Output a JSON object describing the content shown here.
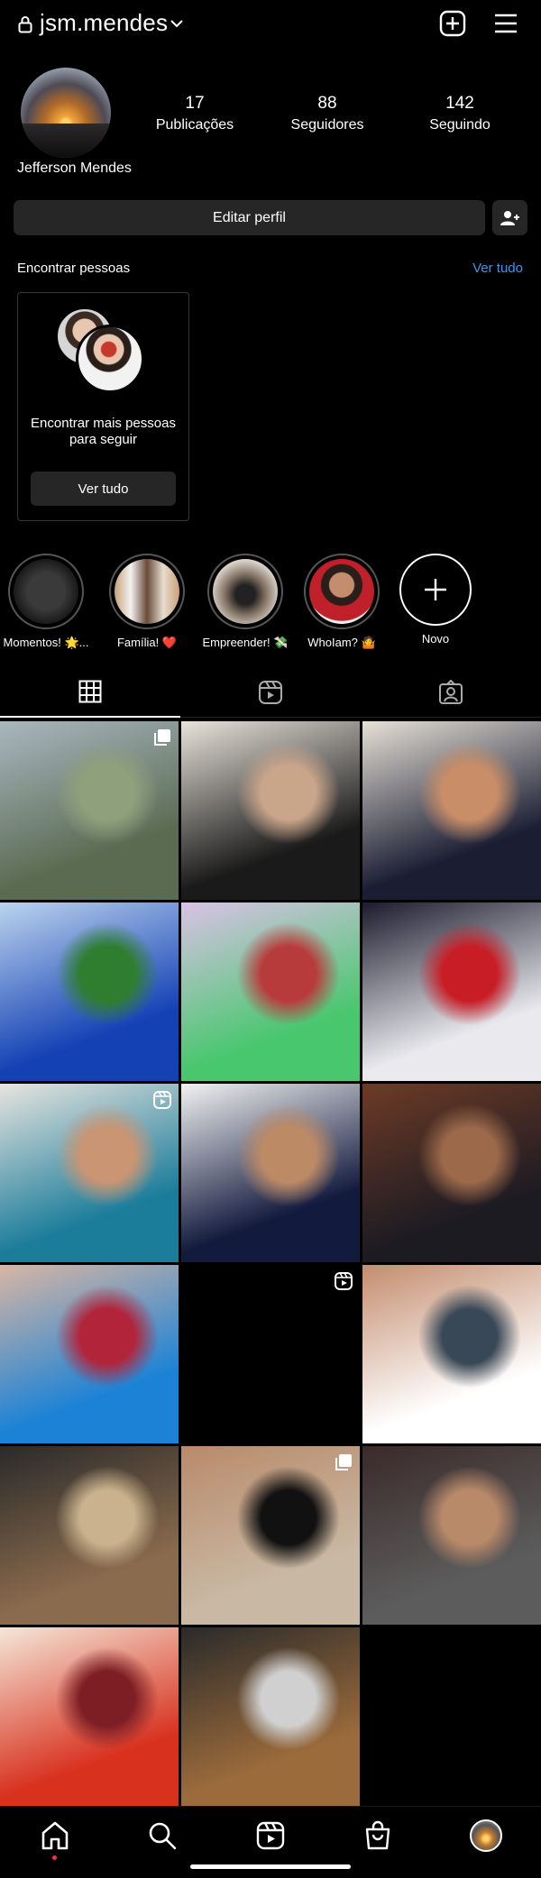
{
  "header": {
    "username": "jsm.mendes",
    "icons": [
      "lock-icon",
      "chevron-down-icon",
      "new-post-icon",
      "menu-icon"
    ]
  },
  "profile": {
    "full_name": "Jefferson Mendes",
    "stats": [
      {
        "value": "17",
        "label": "Publicações"
      },
      {
        "value": "88",
        "label": "Seguidores"
      },
      {
        "value": "142",
        "label": "Seguindo"
      }
    ],
    "edit_label": "Editar perfil"
  },
  "discover": {
    "title": "Encontrar pessoas",
    "see_all": "Ver tudo",
    "card_text": "Encontrar mais pessoas para seguir",
    "card_button": "Ver tudo"
  },
  "highlights": [
    {
      "label": "Momentos! 🌟..."
    },
    {
      "label": "Família! ❤️"
    },
    {
      "label": "Empreender! 💸"
    },
    {
      "label": "WhoIam? 🤷"
    },
    {
      "label": "Novo"
    }
  ],
  "tabs": [
    "grid-tab",
    "reels-tab",
    "tagged-tab"
  ],
  "colors": {
    "background": "#000000",
    "button_bg": "#262626",
    "link": "#3897f0",
    "notification_dot": "#ff3040"
  },
  "grid_posts": [
    {
      "badge": "multiple-posts-icon",
      "palette": [
        "#5b6b52",
        "#8fa07c",
        "#a9b7c0"
      ]
    },
    {
      "badge": "",
      "palette": [
        "#1a1a1a",
        "#c9a58a",
        "#e8e3da"
      ]
    },
    {
      "badge": "",
      "palette": [
        "#1b1e33",
        "#c98e67",
        "#e6e0d6"
      ]
    },
    {
      "badge": "",
      "palette": [
        "#1442b5",
        "#2f7d2f",
        "#bcd3ee"
      ]
    },
    {
      "badge": "",
      "palette": [
        "#49c76e",
        "#b83b3b",
        "#d9c2e6"
      ]
    },
    {
      "badge": "",
      "palette": [
        "#e9e9ee",
        "#c81d25",
        "#1b1b2d"
      ]
    },
    {
      "badge": "reels-badge-icon",
      "palette": [
        "#1c7d9b",
        "#c99573",
        "#e7e4df"
      ]
    },
    {
      "badge": "",
      "palette": [
        "#121a3d",
        "#bd8a66",
        "#f2f2f2"
      ]
    },
    {
      "badge": "",
      "palette": [
        "#1d1b22",
        "#9c6a4b",
        "#6d3b26"
      ]
    },
    {
      "badge": "",
      "palette": [
        "#1b82d6",
        "#b1243a",
        "#d8b6a4"
      ]
    },
    {
      "badge": "reels-badge-icon",
      "palette": [
        "#000000",
        "#000000",
        "#000000"
      ]
    },
    {
      "badge": "",
      "palette": [
        "#ffffff",
        "#394856",
        "#c48d6e"
      ]
    },
    {
      "badge": "",
      "palette": [
        "#8a6b4d",
        "#c9b28d",
        "#2a2a2a"
      ]
    },
    {
      "badge": "multiple-posts-icon",
      "palette": [
        "#c9b9a4",
        "#111111",
        "#b98a6a"
      ]
    },
    {
      "badge": "",
      "palette": [
        "#5c5c5c",
        "#b98a6a",
        "#3b2a2a"
      ]
    },
    {
      "badge": "",
      "palette": [
        "#d8321f",
        "#7d1e25",
        "#f5e7d8"
      ]
    },
    {
      "badge": "",
      "palette": [
        "#9b6b3b",
        "#d0d0d0",
        "#2a2a2a"
      ]
    }
  ],
  "bottom_nav": [
    "home-icon",
    "search-icon",
    "reels-icon",
    "shop-icon",
    "profile-avatar"
  ]
}
